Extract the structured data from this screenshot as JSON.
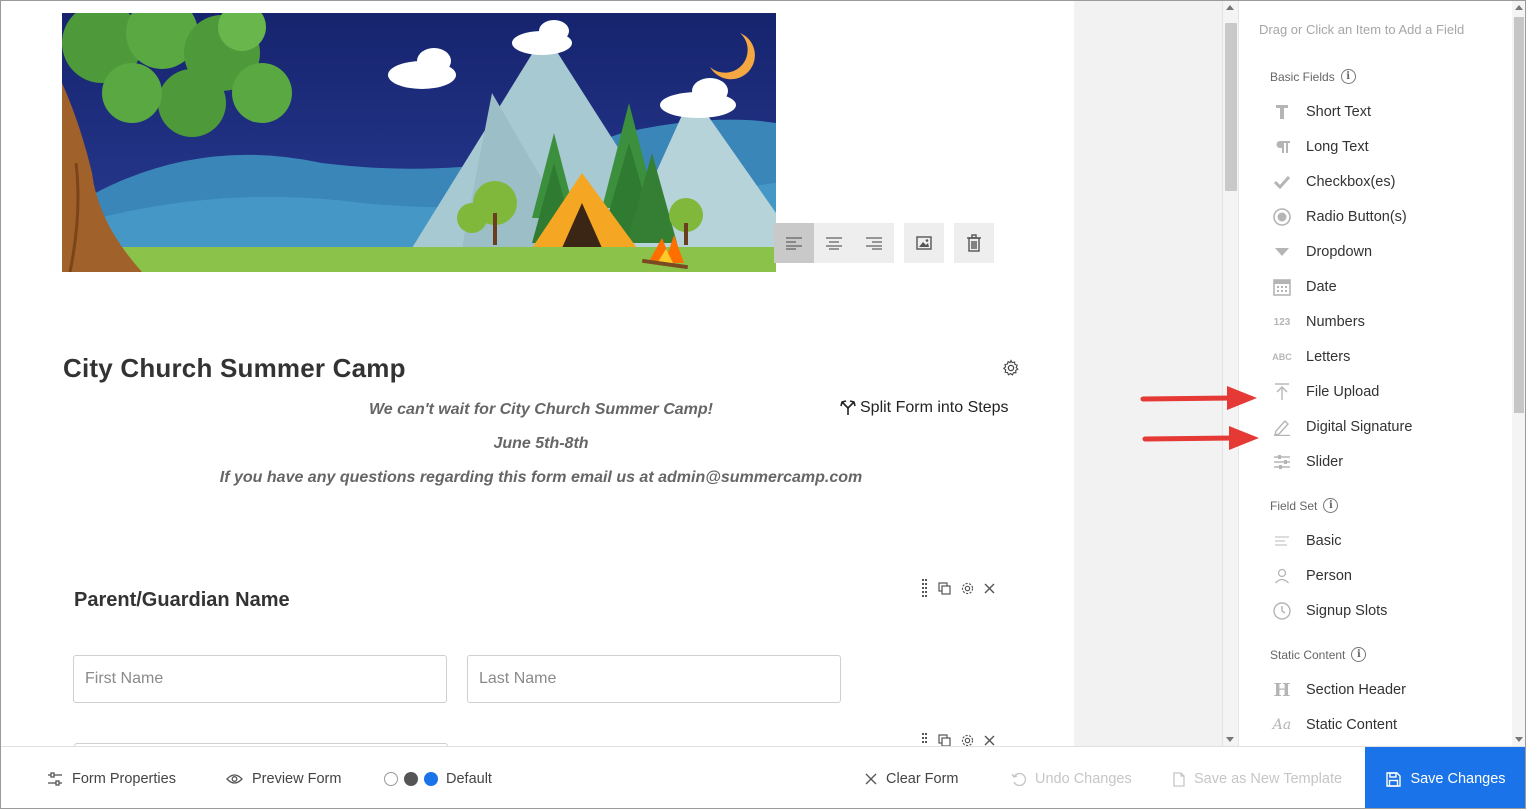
{
  "form": {
    "title": "City Church Summer Camp",
    "split_label": "Split Form into Steps",
    "description": [
      "We can't wait for City Church Summer Camp!",
      "June 5th-8th",
      "If you have any questions regarding this form email us at admin@summercamp.com"
    ],
    "field": {
      "heading": "Parent/Guardian Name",
      "first_placeholder": "First Name",
      "last_placeholder": "Last Name"
    }
  },
  "sidebar": {
    "hint": "Drag or Click an Item to Add a Field",
    "sections": [
      {
        "title": "Basic Fields",
        "items": [
          {
            "label": "Short Text",
            "icon": "text-t-icon"
          },
          {
            "label": "Long Text",
            "icon": "paragraph-icon"
          },
          {
            "label": "Checkbox(es)",
            "icon": "checkmark-icon"
          },
          {
            "label": "Radio Button(s)",
            "icon": "radio-icon"
          },
          {
            "label": "Dropdown",
            "icon": "caret-down-icon"
          },
          {
            "label": "Date",
            "icon": "calendar-icon"
          },
          {
            "label": "Numbers",
            "icon": "numbers-123-icon"
          },
          {
            "label": "Letters",
            "icon": "letters-abc-icon"
          },
          {
            "label": "File Upload",
            "icon": "upload-arrow-icon"
          },
          {
            "label": "Digital Signature",
            "icon": "pencil-icon"
          },
          {
            "label": "Slider",
            "icon": "sliders-icon"
          }
        ]
      },
      {
        "title": "Field Set",
        "items": [
          {
            "label": "Basic",
            "icon": "lines-icon"
          },
          {
            "label": "Person",
            "icon": "person-icon"
          },
          {
            "label": "Signup Slots",
            "icon": "clock-icon"
          }
        ]
      },
      {
        "title": "Static Content",
        "items": [
          {
            "label": "Section Header",
            "icon": "header-h-icon"
          },
          {
            "label": "Static Content",
            "icon": "static-aa-icon"
          }
        ]
      }
    ]
  },
  "bottombar": {
    "form_properties": "Form Properties",
    "preview_form": "Preview Form",
    "theme_label": "Default",
    "clear_form": "Clear Form",
    "undo_changes": "Undo Changes",
    "save_template": "Save as New Template",
    "save_changes": "Save Changes"
  },
  "colors": {
    "accent": "#1a73e8",
    "annotation_arrow": "#e53935"
  }
}
